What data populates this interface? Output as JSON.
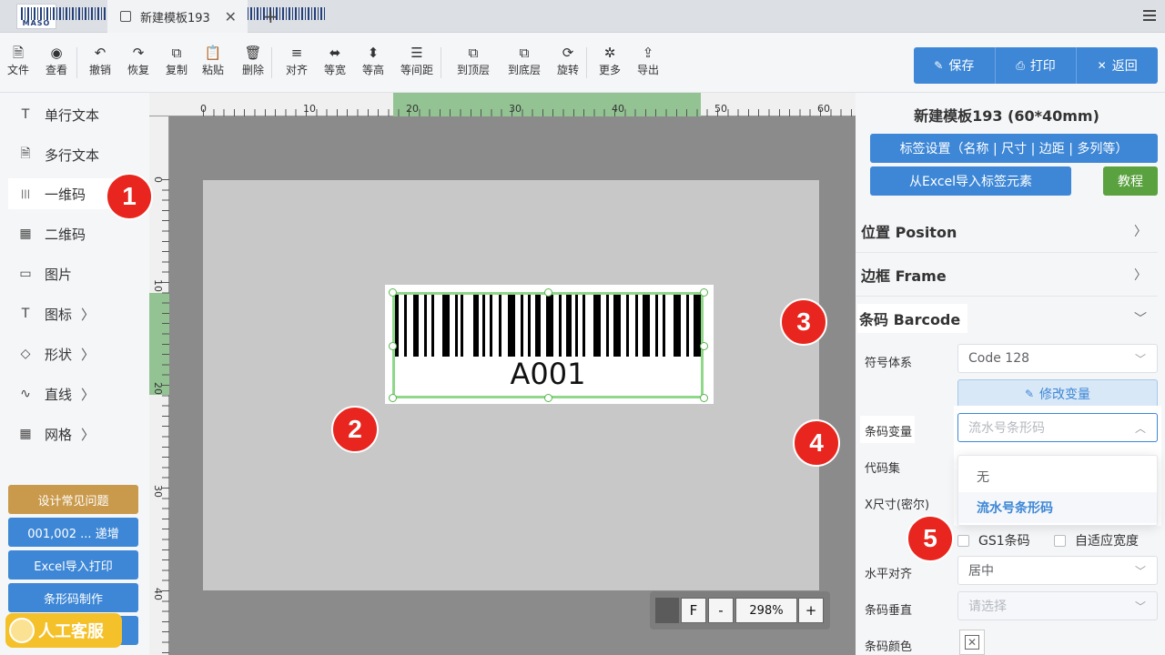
{
  "tabbar": {
    "brand": "MASO",
    "tab_title": "新建模板193",
    "close": "✕",
    "add": "+"
  },
  "toolbar": {
    "items": [
      {
        "icon": "file-icon",
        "glyph": "🗎",
        "label": "文件"
      },
      {
        "icon": "eye-icon",
        "glyph": "◉",
        "label": "查看"
      },
      {
        "icon": "undo-icon",
        "glyph": "↶",
        "label": "撤销"
      },
      {
        "icon": "redo-icon",
        "glyph": "↷",
        "label": "恢复"
      },
      {
        "icon": "copy-icon",
        "glyph": "⧉",
        "label": "复制"
      },
      {
        "icon": "paste-icon",
        "glyph": "📋",
        "label": "粘贴"
      },
      {
        "icon": "trash-icon",
        "glyph": "🗑",
        "label": "删除"
      },
      {
        "icon": "align-icon",
        "glyph": "≡",
        "label": "对齐"
      },
      {
        "icon": "equal-width-icon",
        "glyph": "⬌",
        "label": "等宽"
      },
      {
        "icon": "equal-height-icon",
        "glyph": "⬍",
        "label": "等高"
      },
      {
        "icon": "equal-spacing-icon",
        "glyph": "☰",
        "label": "等间距"
      },
      {
        "icon": "bring-front-icon",
        "glyph": "⧉",
        "label": "到顶层"
      },
      {
        "icon": "send-back-icon",
        "glyph": "⧉",
        "label": "到底层"
      },
      {
        "icon": "rotate-icon",
        "glyph": "⟳",
        "label": "旋转"
      },
      {
        "icon": "more-icon",
        "glyph": "✲",
        "label": "更多"
      },
      {
        "icon": "export-icon",
        "glyph": "⇪",
        "label": "导出"
      }
    ],
    "save": "保存",
    "print": "打印",
    "back": "返回"
  },
  "sidebar": {
    "items": [
      {
        "icon": "text-icon",
        "glyph": "T",
        "label": "单行文本"
      },
      {
        "icon": "multiline-text-icon",
        "glyph": "🗎",
        "label": "多行文本"
      },
      {
        "icon": "barcode-icon",
        "glyph": "|||",
        "label": "一维码"
      },
      {
        "icon": "qrcode-icon",
        "glyph": "▦",
        "label": "二维码"
      },
      {
        "icon": "image-icon",
        "glyph": "▭",
        "label": "图片"
      },
      {
        "icon": "icon-set-icon",
        "glyph": "T",
        "label": "图标"
      },
      {
        "icon": "shape-icon",
        "glyph": "◇",
        "label": "形状"
      },
      {
        "icon": "line-icon",
        "glyph": "∿",
        "label": "直线"
      },
      {
        "icon": "grid-icon",
        "glyph": "▦",
        "label": "网格"
      }
    ],
    "buttons": [
      "设计常见问题",
      "001,002 ... 递增",
      "Excel导入打印",
      "条形码制作"
    ],
    "service": "人工客服"
  },
  "ruler": {
    "top": [
      "0",
      "10",
      "20",
      "30",
      "40",
      "50",
      "60"
    ],
    "left": [
      "0",
      "10",
      "20",
      "30",
      "40"
    ]
  },
  "canvas": {
    "barcode_text": "A001",
    "zoom": "298%",
    "zoom_f": "F",
    "zoom_minus": "-",
    "zoom_plus": "+"
  },
  "panel": {
    "title": "新建模板193 (60*40mm)",
    "label_settings": "标签设置（名称 | 尺寸 | 边距 | 多列等）",
    "import_excel": "从Excel导入标签元素",
    "tutorial": "教程",
    "sections": {
      "position": "位置 Positon",
      "frame": "边框 Frame",
      "barcode": "条码 Barcode"
    },
    "fields": {
      "symbology_label": "符号体系",
      "symbology_value": "Code 128",
      "modify_variable": "修改变量",
      "variable_label": "条码变量",
      "variable_value": "流水号条形码",
      "charset_label": "代码集",
      "xsize_label": "X尺寸(密尔)",
      "gs1": "GS1条码",
      "auto_width": "自适应宽度",
      "halign_label": "水平对齐",
      "halign_value": "居中",
      "valign_label": "条码垂直",
      "valign_placeholder": "请选择",
      "color_label": "条码颜色"
    },
    "dropdown": [
      "无",
      "流水号条形码"
    ]
  },
  "callouts": [
    "1",
    "2",
    "3",
    "4",
    "5"
  ]
}
